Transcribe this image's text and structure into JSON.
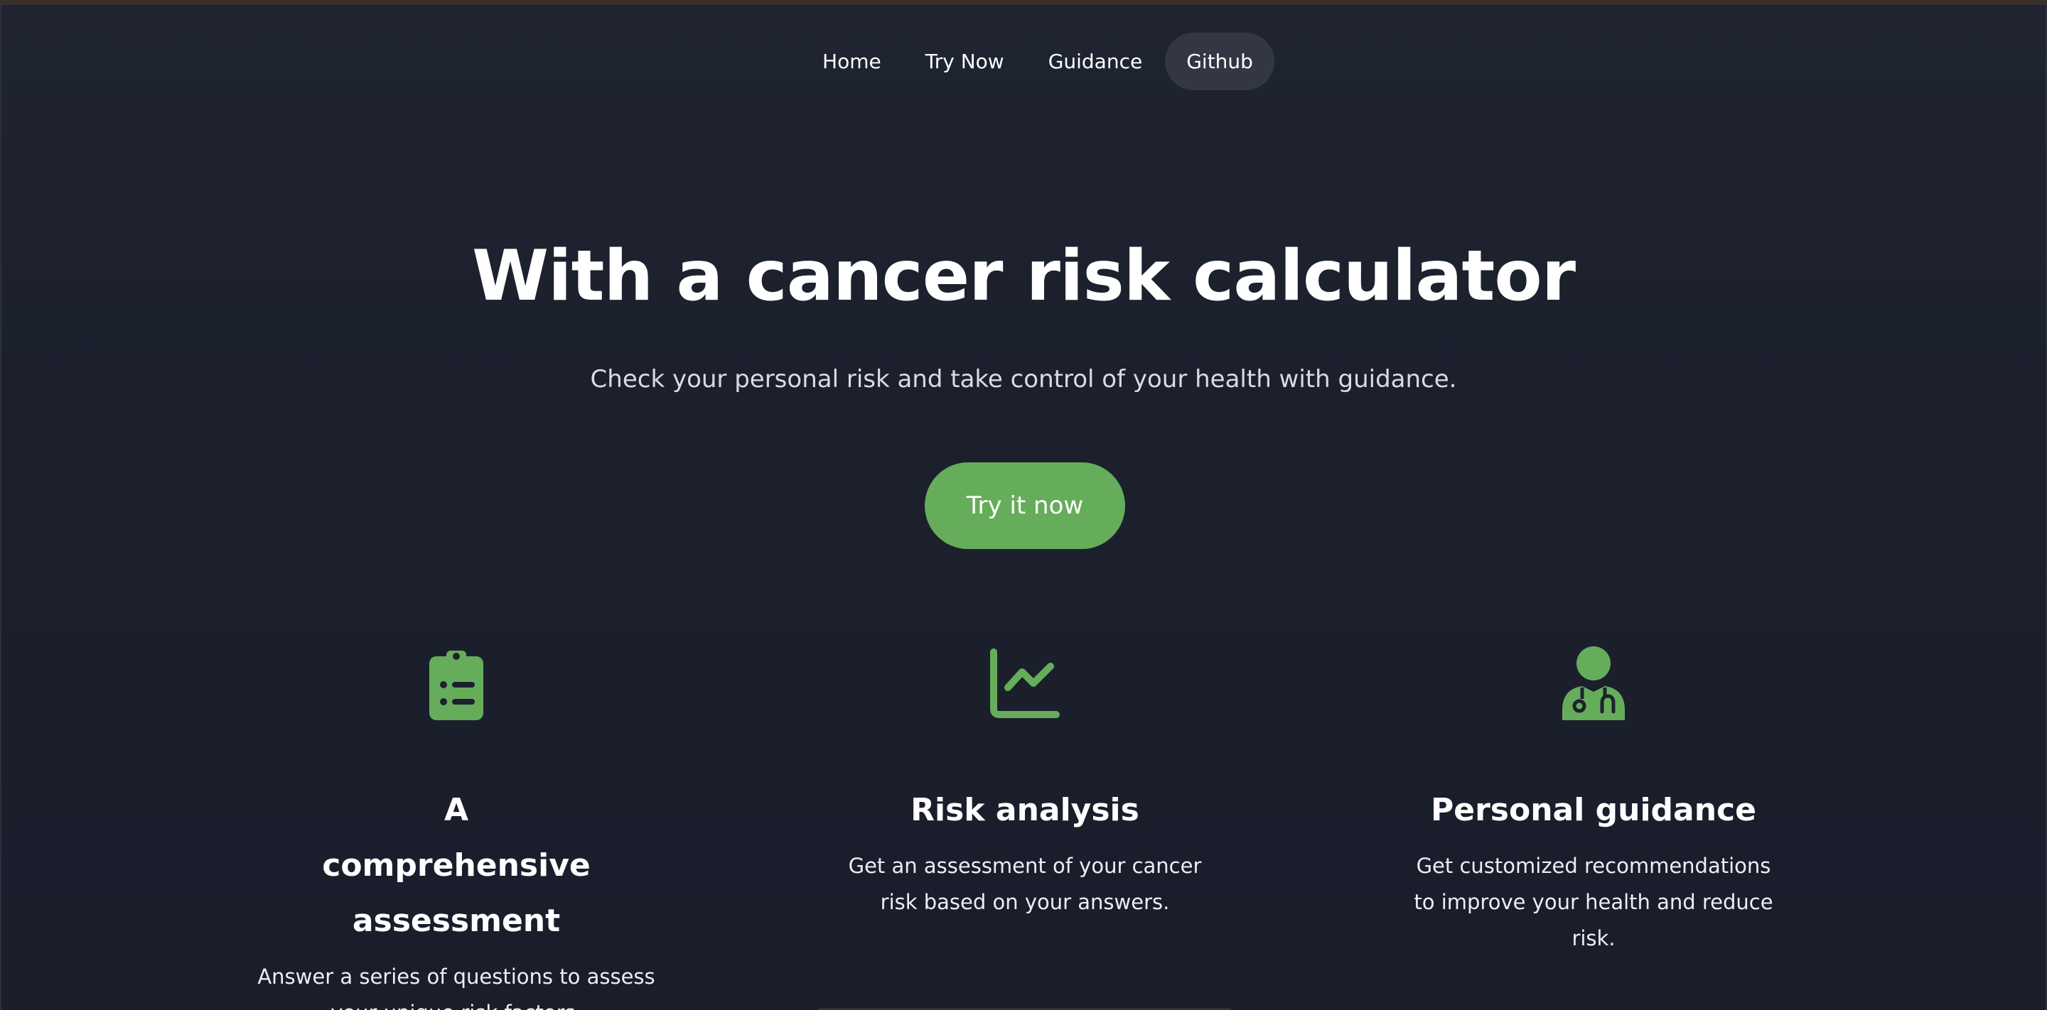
{
  "nav": {
    "items": [
      {
        "label": "Home"
      },
      {
        "label": "Try Now"
      },
      {
        "label": "Guidance"
      },
      {
        "label": "Github"
      }
    ]
  },
  "hero": {
    "title": "With a cancer risk calculator",
    "subtitle": "Check your personal risk and take control of your health with guidance.",
    "cta_label": "Try it now"
  },
  "features": [
    {
      "icon": "clipboard-list-icon",
      "title": "A comprehensive assessment",
      "description": "Answer a series of questions to assess your unique risk factors."
    },
    {
      "icon": "chart-line-icon",
      "title": "Risk analysis",
      "description": "Get an assessment of your cancer risk based on your answers."
    },
    {
      "icon": "doctor-icon",
      "title": "Personal guidance",
      "description": "Get customized recommendations to improve your health and reduce risk."
    }
  ],
  "colors": {
    "background": "#1c202d",
    "accent": "#66ad5b",
    "nav_active_bg": "#323743",
    "text": "#ffffff"
  }
}
